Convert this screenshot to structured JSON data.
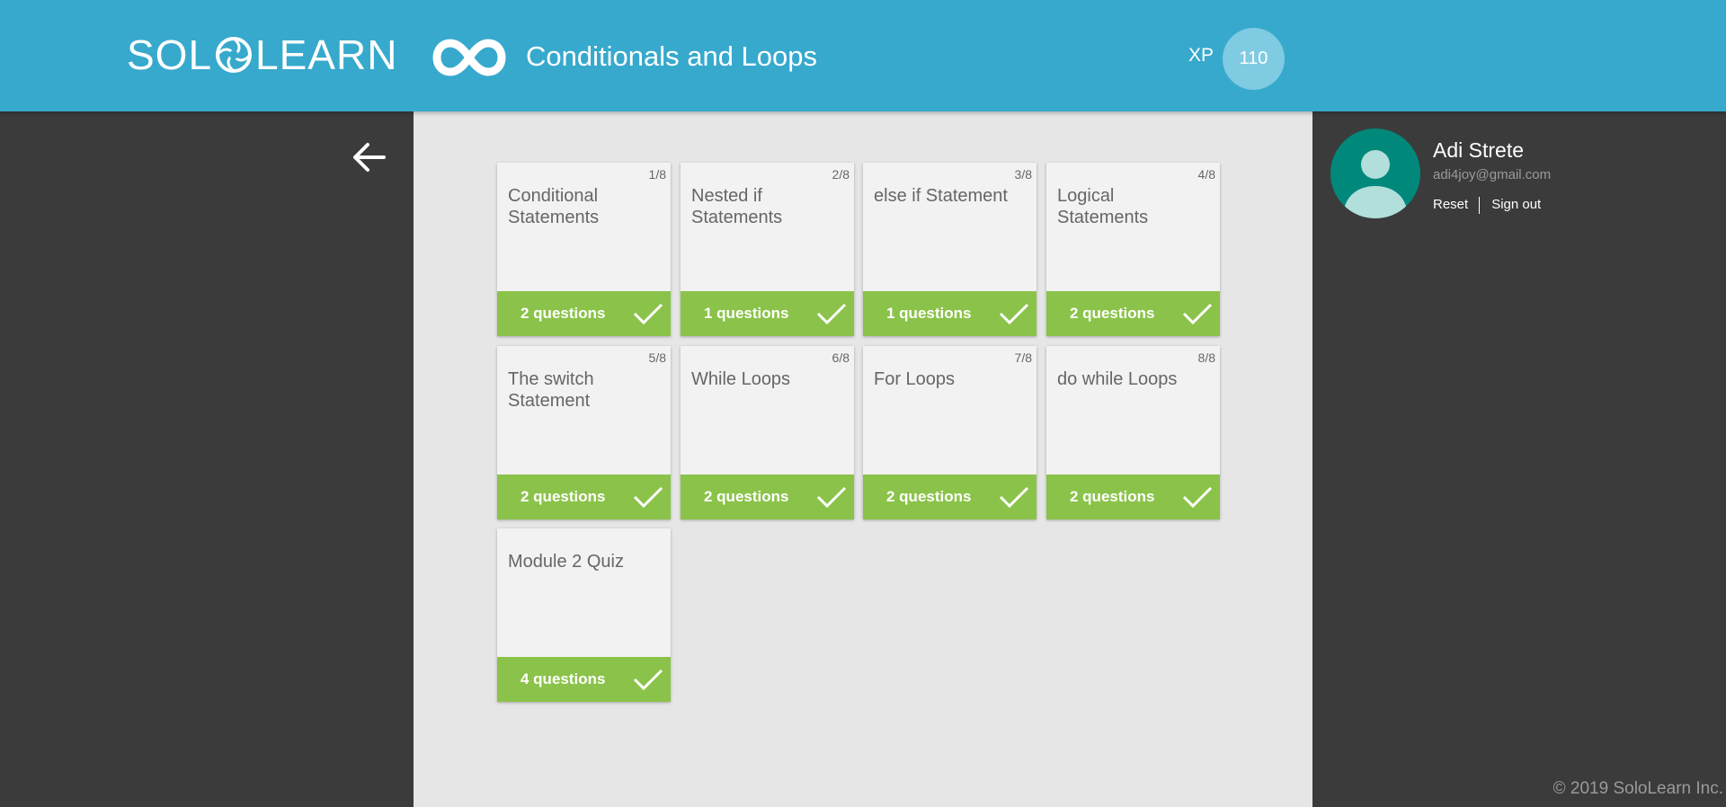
{
  "header": {
    "logo_left": "SOL",
    "logo_right": "LEARN",
    "course_icon": "infinity-icon",
    "course_title": "Conditionals and Loops",
    "xp_label": "XP",
    "xp_value": "110"
  },
  "colors": {
    "header": "#37a9cd",
    "xp_badge": "#7fcbe2",
    "completed_bar": "#8bc34a",
    "avatar": "#00897b",
    "side_background": "#3b3b3b",
    "main_background": "#e6e6e6"
  },
  "navigation": {
    "back_icon": "arrow-left-icon"
  },
  "lessons": [
    {
      "number": "1/8",
      "title": "Conditional Statements",
      "questions": "2 questions",
      "completed": true
    },
    {
      "number": "2/8",
      "title": "Nested if Statements",
      "questions": "1 questions",
      "completed": true
    },
    {
      "number": "3/8",
      "title": "else if Statement",
      "questions": "1 questions",
      "completed": true
    },
    {
      "number": "4/8",
      "title": "Logical Statements",
      "questions": "2 questions",
      "completed": true
    },
    {
      "number": "5/8",
      "title": "The switch Statement",
      "questions": "2 questions",
      "completed": true
    },
    {
      "number": "6/8",
      "title": "While Loops",
      "questions": "2 questions",
      "completed": true
    },
    {
      "number": "7/8",
      "title": "For Loops",
      "questions": "2 questions",
      "completed": true
    },
    {
      "number": "8/8",
      "title": "do while Loops",
      "questions": "2 questions",
      "completed": true
    },
    {
      "number": "",
      "title": "Module 2 Quiz",
      "questions": "4 questions",
      "completed": true
    }
  ],
  "user": {
    "avatar_icon": "user-avatar-icon",
    "name": "Adi Strete",
    "email": "adi4joy@gmail.com",
    "reset_label": "Reset",
    "signout_label": "Sign out"
  },
  "footer": {
    "copyright": "© 2019 SoloLearn Inc."
  }
}
